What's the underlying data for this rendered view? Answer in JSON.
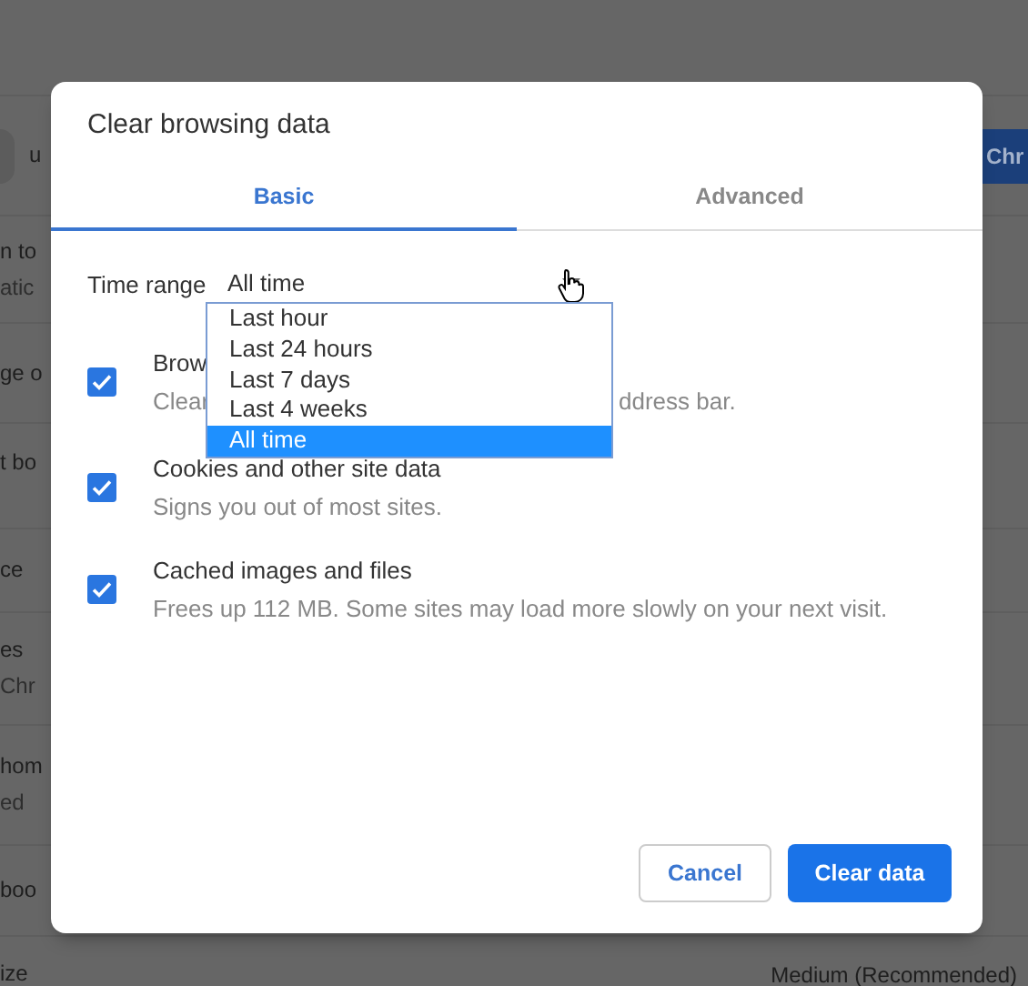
{
  "background": {
    "rows": [
      {
        "left": [
          "u"
        ],
        "avatar": true,
        "right": {
          "text": "Chr",
          "kind": "button"
        }
      },
      {
        "left": [
          "n to",
          "atic"
        ]
      },
      {
        "left": [
          "ge o"
        ]
      },
      {
        "left": [
          "t bo"
        ]
      },
      {
        "left": [
          "ce"
        ]
      },
      {
        "left": [
          "es",
          "Chr"
        ]
      },
      {
        "left": [
          "hom",
          "ed"
        ]
      },
      {
        "left": [
          "boo"
        ]
      },
      {
        "left": [
          "ize"
        ],
        "right": {
          "text": "Medium (Recommended)",
          "kind": "text"
        }
      }
    ]
  },
  "dialog": {
    "title": "Clear browsing data",
    "tabs": [
      {
        "label": "Basic",
        "selected": true
      },
      {
        "label": "Advanced",
        "selected": false
      }
    ],
    "time_range": {
      "label": "Time range",
      "value": "All time",
      "open": true,
      "options": [
        {
          "label": "Last hour",
          "selected": false
        },
        {
          "label": "Last 24 hours",
          "selected": false
        },
        {
          "label": "Last 7 days",
          "selected": false
        },
        {
          "label": "Last 4 weeks",
          "selected": false
        },
        {
          "label": "All time",
          "selected": true
        }
      ]
    },
    "items": [
      {
        "title": "Brow",
        "description": [
          "Clear",
          "ddress bar."
        ],
        "checked": true
      },
      {
        "title": "Cookies and other site data",
        "description": [
          "Signs you out of most sites."
        ],
        "checked": true
      },
      {
        "title": "Cached images and files",
        "description": [
          "Frees up 112 MB. Some sites may load more slowly on your next visit."
        ],
        "checked": true
      }
    ],
    "buttons": [
      {
        "label": "Cancel",
        "kind": "secondary"
      },
      {
        "label": "Clear data",
        "kind": "primary"
      }
    ]
  }
}
